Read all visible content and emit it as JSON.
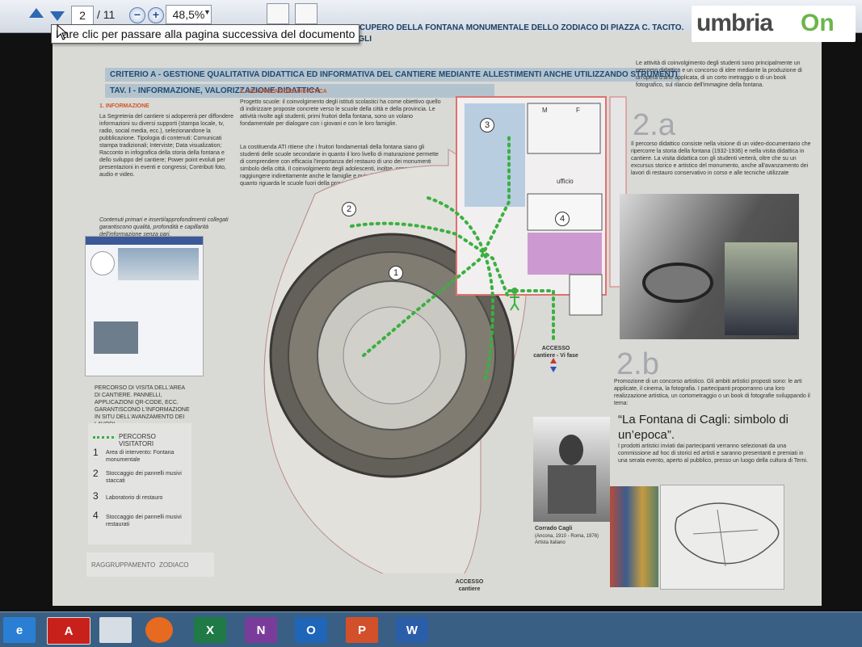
{
  "toolbar": {
    "current_page": "2",
    "total_pages": "/ 11",
    "zoom": "48,5%",
    "tooltip": "Fare clic per passare alla pagina successiva del documento"
  },
  "document": {
    "top_header": "RECUPERO DELLA FONTANA MONUMENTALE DELLO ZODIACO DI PIAZZA C. TACITO.",
    "subtitle": "STACCO E RIPRISTINO DELL'OPERA MUSIVA DI CORRADO CAGLI",
    "criterion_header": "CRITERIO A - GESTIONE QUALITATIVA DIDATTICA ED INFORMATIVA DEL CANTIERE MEDIANTE ALLESTIMENTI ANCHE UTILIZZANDO STRUMENTI MULTIMEDIALI",
    "tav_header": "TAV. I - INFORMAZIONE, VALORIZZAZIONE DIDATTICA",
    "section1_title": "1. INFORMAZIONE",
    "section1_text": "La Segreteria del cantiere si adopererà per diffondere informazioni su diversi supporti (stampa locale, tv, radio, social media, ecc.), selezionandone la pubblicazione. Tipologia di contenuti: Comunicati stampa tradizionali; Interviste; Data visualization; Racconto in infografica della storia della fontana e dello sviluppo del cantiere; Power point evoluti per presentazioni in eventi e congressi; Contributi foto, audio e video.",
    "section1_text2": "Contenuti primari e inserti/approfondimenti collegati garantiscono qualità, profondità e capillarità dell'informazione senza pari.",
    "section2_title": "2. VALORIZZAZIONE DIDATTICA",
    "section2_text": "Progetto scuole: il coinvolgimento degli istituti scolastici ha come obiettivo quello di indirizzare proposte concrete verso le scuole della città e della provincia. Le attività rivolte agli studenti, primi fruitori della fontana, sono un volano fondamentale per dialogare con i giovani e con le loro famiglie.",
    "section2_text2": "La costituenda ATI ritiene che i fruitori fondamentali della fontana siano gli studenti delle scuole secondarie in quanto il loro livello di maturazione permette di comprendere con efficacia l'importanza del restauro di uno dei monumenti simbolo della città. Il coinvolgimento degli adolescenti, inoltre, consente di raggiungere indirettamente anche le famiglie e quindi la cittadinanza e, per quanto riguarda le scuole fuori della provincia di Terni, anche potenziali turisti.",
    "right_intro": "Le attività di coinvolgimento degli studenti sono principalmente un percorso didattico e un concorso di idee mediante la produzione di un'opera d'arte applicata, di un corto metraggio o di un book fotografico, sul rilancio dell'immagine della fontana.",
    "label_2a": "2.a",
    "text_2a": "Il percorso didattico consiste nella visione di un video-documentario che ripercorre la storia della fontana (1932-1936) e nella visita didattica in cantiere. La visita didattica con gli studenti verterà, oltre che su un excursus storico e artistico del monumento, anche all'avanzamento dei lavori di restauro conservativo in corso e alle tecniche utilizzate",
    "label_2b": "2.b",
    "text_2b": "Promozione di un concorso artistico. Gli ambiti artistici proposti sono: le arti applicate, il cinema, la fotografia. I partecipanti proporranno una loro realizzazione artistica, un cortometraggio o un book di fotografie sviluppando il tema:",
    "quote": "“La Fontana di Cagli: simbolo di un’epoca”.",
    "text_2b_2": "I prodotti artistici inviati dai partecipanti verranno selezionati da una commissione ad hoc di storici ed artisti e saranno presentanti e premiati in una serata evento, aperto al pubblico, presso un luogo della cultura di Terni.",
    "artist_name": "Corrado Cagli",
    "artist_dates": "(Ancona, 1910 - Roma, 1976)",
    "artist_role": "Artista italiano",
    "route_note": "PERCORSO DI VISITA DELL'AREA DI CANTIERE. PANNELLI, APPLICAZIONI QR-CODE, ECC. GARANTISCONO L'INFORMAZIONE IN SITU DELL'AVANZAMENTO DEI LAVORI",
    "legend": {
      "title": "PERCORSO VISITATORI",
      "items": [
        {
          "num": "1",
          "text": "Area di intervento: Fontana monumentale"
        },
        {
          "num": "2",
          "text": "Stoccaggio dei pannelli musivi staccati"
        },
        {
          "num": "3",
          "text": "Laboratorio di restauro"
        },
        {
          "num": "4",
          "text": "Stoccaggio dei pannelli musivi restaurati"
        }
      ]
    },
    "footer_brand_1": "RAGGRUPPAMENTO",
    "footer_brand_2": "ZODIACO",
    "access_cantiere": "ACCESSO cantiere",
    "access_cantiere_vt": "ACCESSO cantiere - Vi fase",
    "room_m": "M",
    "room_f": "F",
    "room_ufficio": "ufficio",
    "map_markers": [
      "1",
      "2",
      "3",
      "4"
    ]
  },
  "watermark": {
    "part1": "umbria",
    "part2": "On"
  },
  "taskbar": {
    "apps": [
      {
        "name": "internet-explorer",
        "label": "e",
        "color": "#2a7fd4"
      },
      {
        "name": "acrobat",
        "label": "A",
        "color": "#c8211b"
      },
      {
        "name": "notepad",
        "label": "",
        "color": "#d7dde4"
      },
      {
        "name": "firefox",
        "label": "",
        "color": "#e66a1f"
      },
      {
        "name": "excel",
        "label": "X",
        "color": "#1f7a45"
      },
      {
        "name": "onenote",
        "label": "N",
        "color": "#7a3c9a"
      },
      {
        "name": "outlook",
        "label": "O",
        "color": "#1f66b8"
      },
      {
        "name": "powerpoint",
        "label": "P",
        "color": "#d2502a"
      },
      {
        "name": "word",
        "label": "W",
        "color": "#2b5ea8"
      }
    ]
  }
}
